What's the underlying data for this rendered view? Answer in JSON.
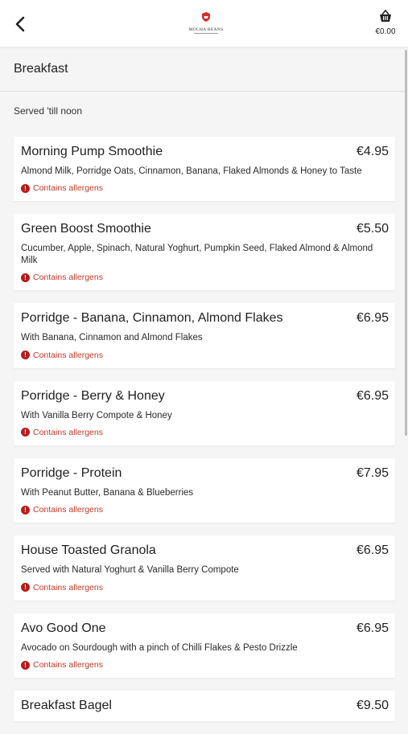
{
  "header": {
    "logo_text": "MOCHA BEANS",
    "basket_total": "€0.00"
  },
  "section": {
    "title": "Breakfast",
    "subtitle": "Served 'till noon"
  },
  "allergen_label": "Contains allergens",
  "colors": {
    "allergen": "#c0392b",
    "logo_accent": "#d32f2f"
  },
  "items": [
    {
      "name": "Morning Pump Smoothie",
      "price": "€4.95",
      "desc": "Almond Milk, Porridge Oats, Cinnamon, Banana, Flaked Almonds & Honey to Taste",
      "allergen": "Contains allergens"
    },
    {
      "name": "Green Boost Smoothie",
      "price": "€5.50",
      "desc": "Cucumber, Apple, Spinach, Natural Yoghurt, Pumpkin Seed, Flaked Almond & Almond Milk",
      "allergen": "Contains allergens"
    },
    {
      "name": "Porridge - Banana, Cinnamon, Almond Flakes",
      "price": "€6.95",
      "desc": "With Banana, Cinnamon and Almond Flakes",
      "allergen": "Contains allergens"
    },
    {
      "name": "Porridge - Berry & Honey",
      "price": "€6.95",
      "desc": "With Vanilla Berry Compote & Honey",
      "allergen": "Contains allergens"
    },
    {
      "name": "Porridge - Protein",
      "price": "€7.95",
      "desc": "With Peanut Butter, Banana & Blueberries",
      "allergen": "Contains allergens"
    },
    {
      "name": "House Toasted Granola",
      "price": "€6.95",
      "desc": "Served with Natural Yoghurt & Vanilla Berry Compote",
      "allergen": "Contains allergens"
    },
    {
      "name": "Avo Good One",
      "price": "€6.95",
      "desc": "Avocado on Sourdough with a pinch of Chilli Flakes & Pesto Drizzle",
      "allergen": "Contains allergens"
    },
    {
      "name": "Breakfast Bagel",
      "price": "€9.50",
      "desc": "",
      "allergen": ""
    }
  ]
}
